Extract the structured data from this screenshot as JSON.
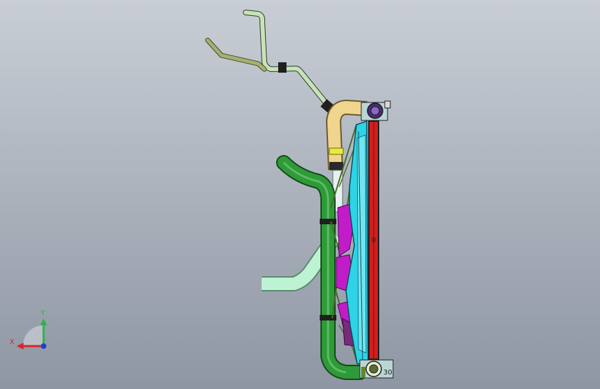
{
  "viewport": {
    "background_top": "#c9ced6",
    "background_bottom": "#8e96a3"
  },
  "model": {
    "colors": {
      "radiator_core": "#d21e1e",
      "radiator_frame": "#1e1e1e",
      "shroud": "#2ed3e6",
      "fan_motor": "#c21cc9",
      "lower_hose": "#2e9a38",
      "upper_hose": "#efd58d",
      "pale_hose": "#bdf2d2",
      "vent_line": "#c8e2b8",
      "clamp": "#1f1f1f"
    },
    "markings": {
      "core_label": "0",
      "bottom_tag": "30"
    }
  },
  "triad": {
    "x_label": "X",
    "y_label": "Y",
    "x_color": "#d9262b",
    "y_color": "#2fb24c",
    "z_color": "#1f3fd8"
  }
}
